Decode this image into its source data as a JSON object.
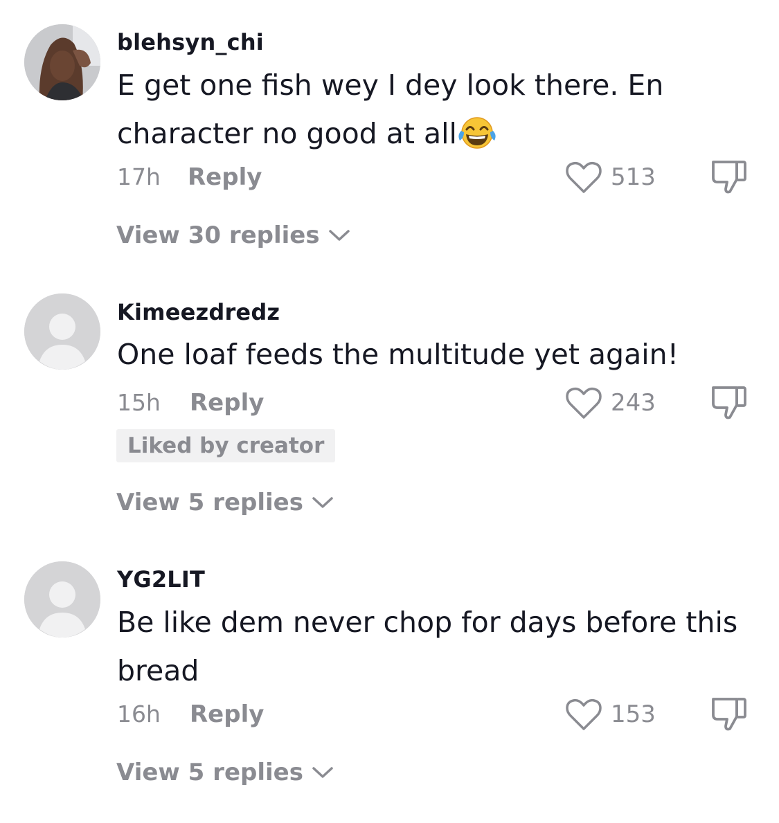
{
  "comments": [
    {
      "username": "blehsyn_chi",
      "text": "E get one fish wey I dey look there. En character no good at all",
      "emoji": "face-with-tears-of-joy",
      "time": "17h",
      "reply_label": "Reply",
      "likes": "513",
      "liked_by_creator": "",
      "view_replies": "View 30 replies",
      "avatar": "user-photo"
    },
    {
      "username": "Kimeezdredz",
      "text": "One loaf feeds the multitude yet again!",
      "time": "15h",
      "reply_label": "Reply",
      "likes": "243",
      "liked_by_creator": "Liked by creator",
      "view_replies": "View 5 replies",
      "avatar": "default-avatar"
    },
    {
      "username": "YG2LIT",
      "text": "Be like dem never chop for days before this bread",
      "time": "16h",
      "reply_label": "Reply",
      "likes": "153",
      "liked_by_creator": "",
      "view_replies": "View 5 replies",
      "avatar": "default-avatar"
    }
  ],
  "colors": {
    "text_primary": "#161823",
    "text_secondary": "#8a8b91",
    "badge_bg": "#f1f1f2",
    "avatar_placeholder": "#d4d4d6"
  },
  "icons": {
    "like": "heart-outline-icon",
    "dislike": "thumbs-down-icon",
    "expand": "chevron-down-icon"
  }
}
